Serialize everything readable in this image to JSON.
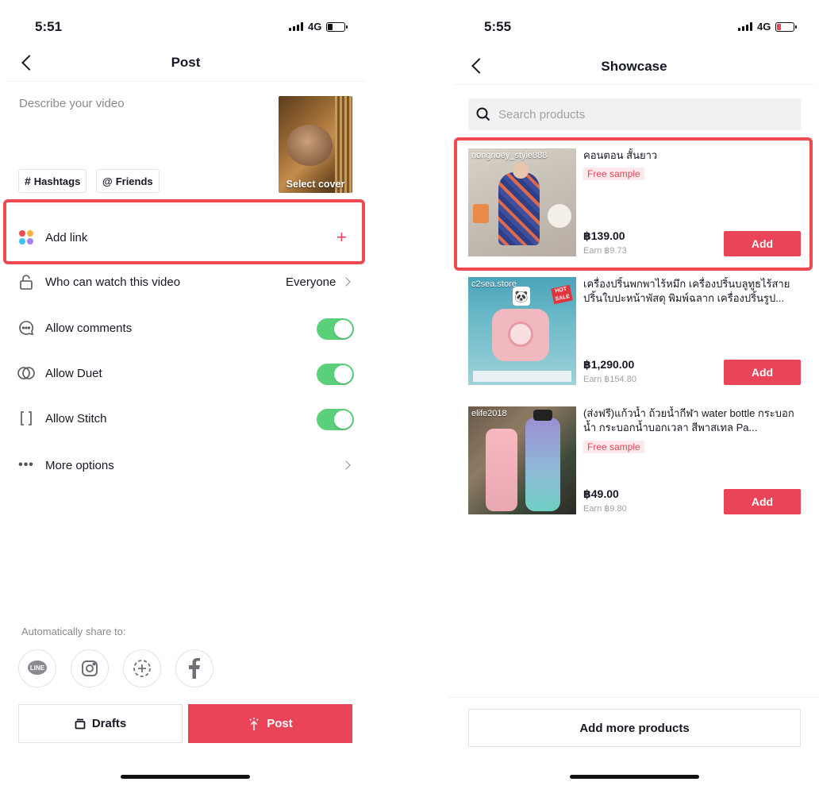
{
  "left": {
    "status_time": "5:51",
    "network": "4G",
    "title": "Post",
    "description_placeholder": "Describe your video",
    "chips": [
      "Hashtags",
      "Friends"
    ],
    "cover_label": "Select cover",
    "add_link": "Add link",
    "who_can_watch": "Who can watch this video",
    "who_can_watch_value": "Everyone",
    "allow_comments": "Allow comments",
    "allow_duet": "Allow Duet",
    "allow_stitch": "Allow Stitch",
    "more_options": "More options",
    "auto_share": "Automatically share to:",
    "share_targets": [
      "LINE",
      "Instagram",
      "Add",
      "Facebook"
    ],
    "drafts": "Drafts",
    "post": "Post",
    "battery_level": 0.2
  },
  "right": {
    "status_time": "5:55",
    "network": "4G",
    "title": "Showcase",
    "search_placeholder": "Search products",
    "products": [
      {
        "shop": "nongnoey_style888",
        "title": "คอนตอน สั้นยาว",
        "badge": "Free sample",
        "price": "฿139.00",
        "earn": "Earn ฿9.73",
        "add": "Add"
      },
      {
        "shop": "c2sea.store",
        "title": "เครื่องปริ้นพกพาไร้หมึก เครื่องปริ้นบลูทูธไร้สาย ปริ้นใบปะหน้าพัสดุ พิมพ์ฉลาก เครื่องปริ้นรูป...",
        "badge": "",
        "price": "฿1,290.00",
        "earn": "Earn ฿154.80",
        "add": "Add"
      },
      {
        "shop": "elife2018",
        "title": "(ส่งฟรี)แก้วน้ำ ถ้วยน้ำกีฬา water bottle กระบอกน้ำ กระบอกน้ำบอกเวลา สีพาสเทล Pa...",
        "badge": "Free sample",
        "price": "฿49.00",
        "earn": "Earn ฿9.80",
        "add": "Add"
      }
    ],
    "add_more": "Add more products",
    "battery_level": 0.15
  },
  "colors": {
    "accent": "#ea4458",
    "toggle_on": "#5ad07a",
    "highlight": "#f04b53"
  }
}
